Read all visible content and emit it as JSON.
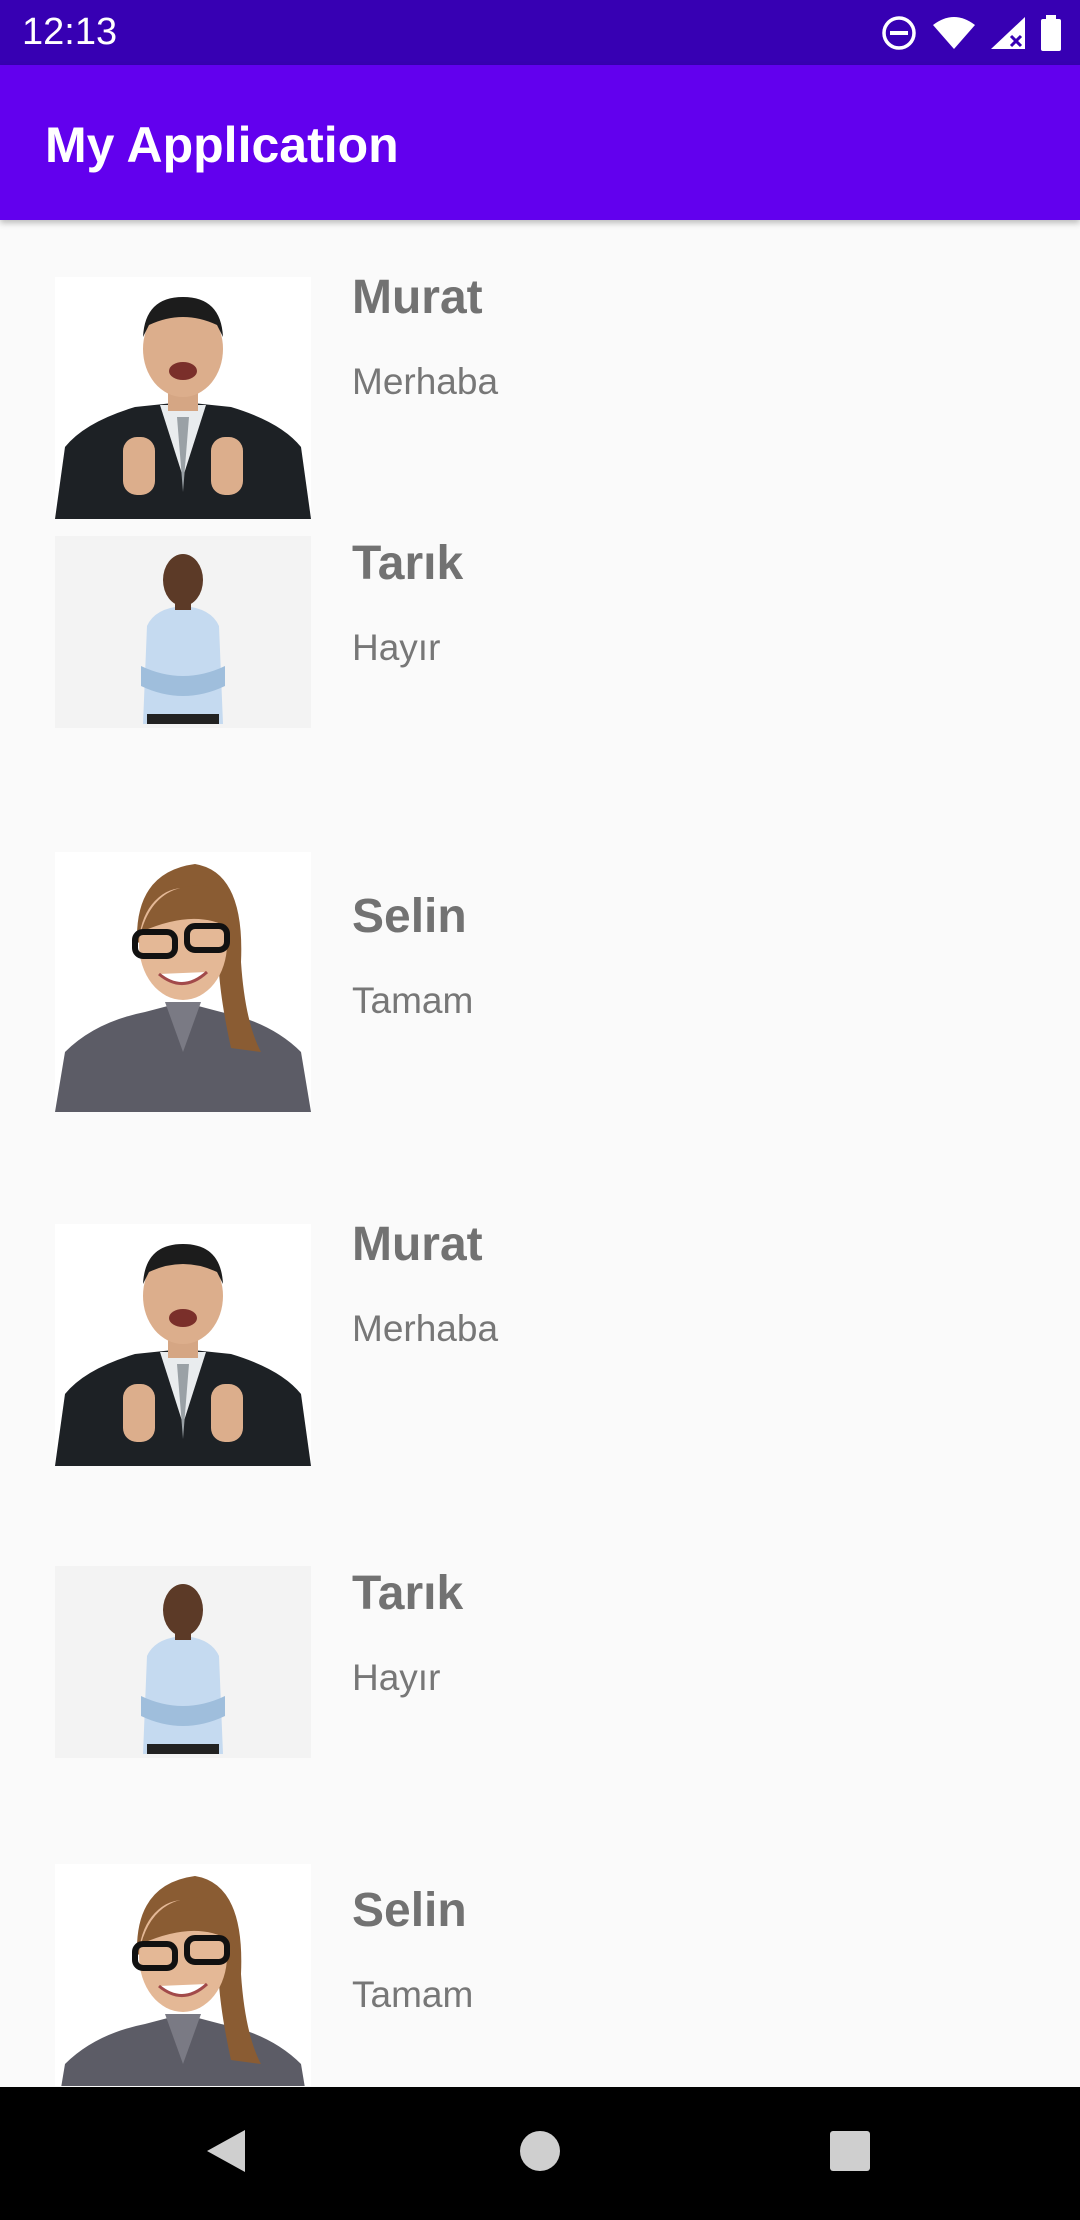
{
  "status_bar": {
    "time": "12:13",
    "icons": [
      "do-not-disturb-icon",
      "wifi-icon",
      "signal-icon",
      "battery-icon"
    ]
  },
  "app_bar": {
    "title": "My Application"
  },
  "contacts": [
    {
      "name": "Murat",
      "message": "Merhaba",
      "photo": "man-suit-thumbs-up"
    },
    {
      "name": "Tarık",
      "message": "Hayır",
      "photo": "man-blue-shirt-arms-crossed"
    },
    {
      "name": "Selin",
      "message": "Tamam",
      "photo": "woman-glasses"
    },
    {
      "name": "Murat",
      "message": "Merhaba",
      "photo": "man-suit-thumbs-up"
    },
    {
      "name": "Tarık",
      "message": "Hayır",
      "photo": "man-blue-shirt-arms-crossed"
    },
    {
      "name": "Selin",
      "message": "Tamam",
      "photo": "woman-glasses"
    }
  ],
  "nav_bar": {
    "icons": [
      "back-icon",
      "home-icon",
      "recents-icon"
    ]
  },
  "colors": {
    "primary": "#6200ee",
    "primary_dark": "#3700b3",
    "text": "#727272",
    "background": "#fafafa"
  }
}
